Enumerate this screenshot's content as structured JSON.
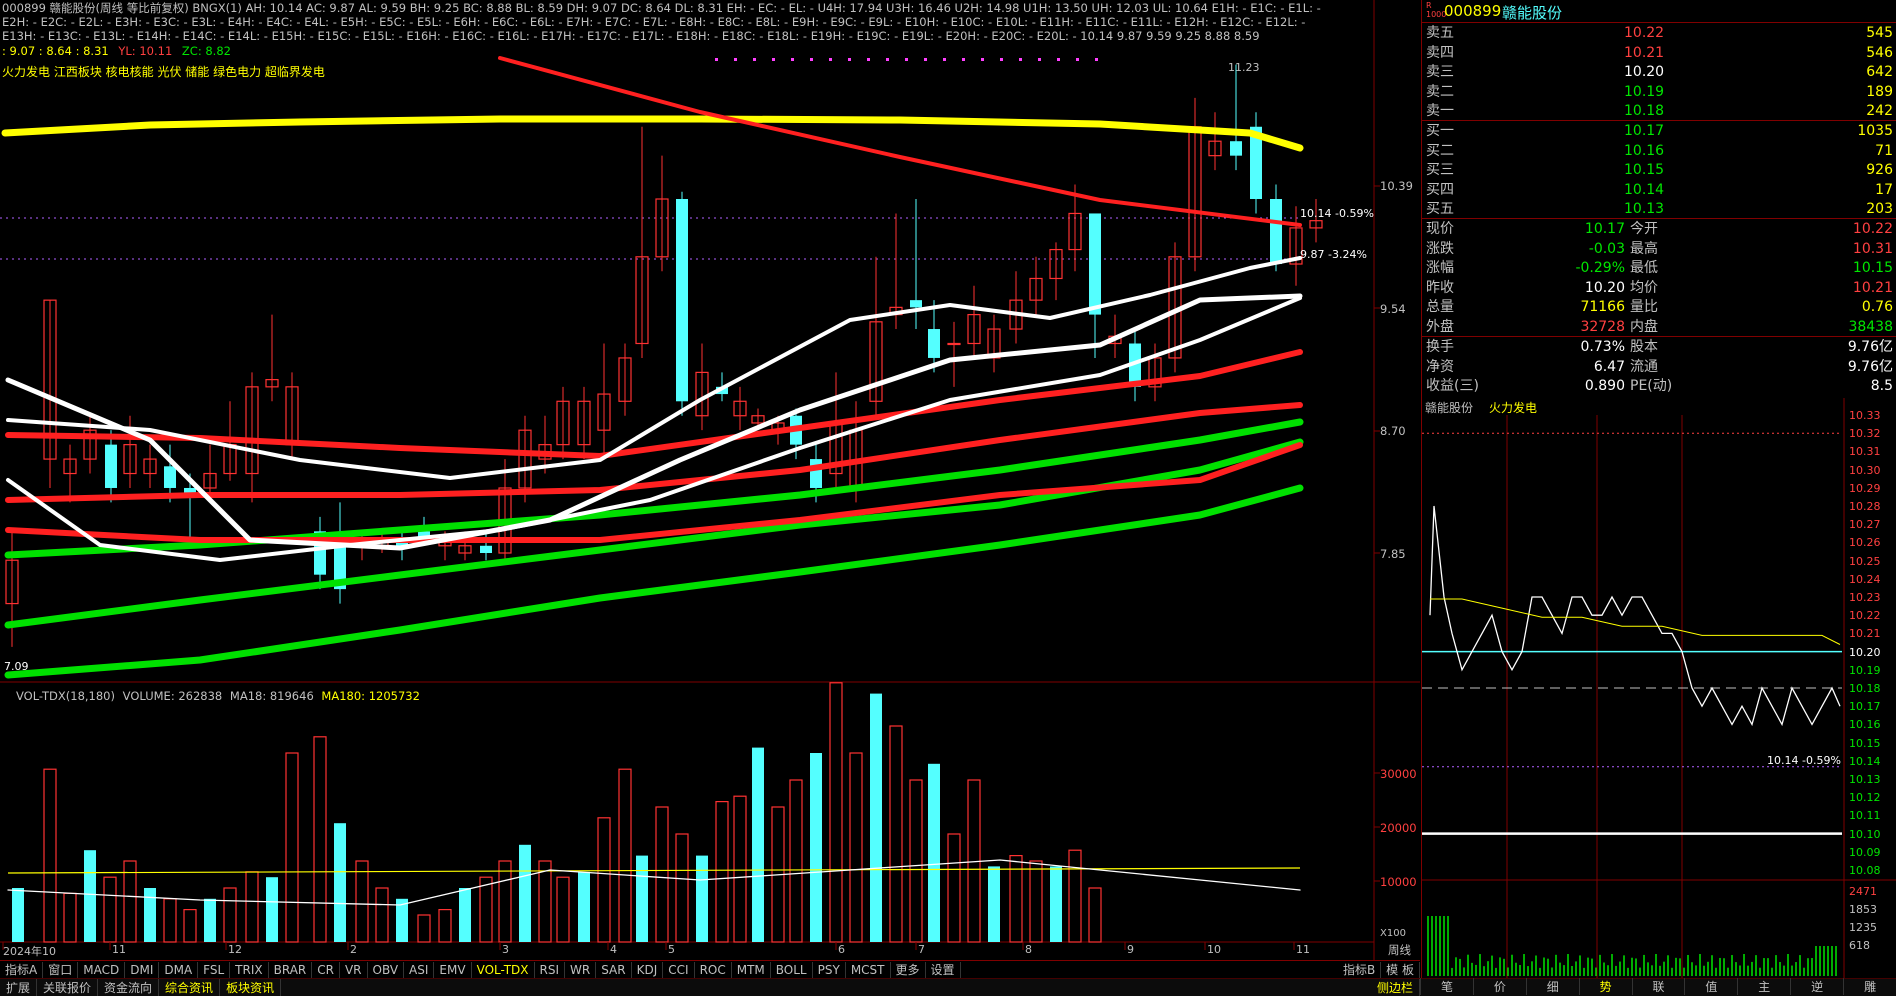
{
  "header": {
    "line1": "000899 赣能股份(周线 等比前复权)   BNGX(1) AH: 10.14  AC: 9.87  AL: 9.59  BH: 9.25  BC: 8.88  BL: 8.59  DH: 9.07  DC: 8.64  DL: 8.31  EH: -  EC: -  EL: -  U4H: 17.94  U3H: 16.46  U2H: 14.98  U1H: 13.50  UH: 12.03  UL: 10.64  E1H: -  E1C: -  E1L: -",
    "line2": "E2H: -  E2C: -  E2L: -  E3H: -  E3C: -  E3L: -  E4H: -  E4C: -  E4L: -  E5H: -  E5C: -  E5L: -  E6H: -  E6C: -  E6L: -  E7H: -  E7C: -  E7L: -  E8H: -  E8C: -  E8L: -  E9H: -  E9C: -  E9L: -  E10H: -  E10C: -  E10L: -  E11H: -  E11C: -  E11L: -  E12H: -  E12C: -  E12L: -",
    "line3": "E13H: -  E13C: -  E13L: -  E14H: -  E14C: -  E14L: -  E15H: -  E15C: -  E15L: -  E16H: -  E16C: -  E16L: -  E17H: -  E17C: -  E17L: -  E18H: -  E18C: -  E18L: -  E19H: -  E19C: -  E19L: -  E20H: -  E20C: -  E20L: -  10.14  9.87  9.59  9.25  8.88  8.59",
    "line4_a": ": 9.07 : 8.64 : 8.31",
    "line4_b": "YL: 10.11",
    "line4_c": "ZC: 8.82"
  },
  "sectors": "火力发电 江西板块 核电核能 光伏 储能 绿色电力 超临界发电",
  "price_axis": [
    "10.39",
    "9.54",
    "8.70",
    "7.85"
  ],
  "price_annotations": {
    "high": "11.23",
    "ref1": "10.14 -0.59%",
    "ref2": "9.87 -3.24%",
    "low": "7.09"
  },
  "volume": {
    "header_name": "VOL-TDX(18,180)",
    "header_volume": "VOLUME: 262838",
    "header_ma18": "MA18: 819646",
    "header_ma180": "MA180: 1205732",
    "axis": [
      "30000",
      "20000",
      "10000"
    ],
    "unit": "X100"
  },
  "time_axis": [
    "2024年10",
    "11",
    "12",
    "2",
    "3",
    "4",
    "5",
    "6",
    "7",
    "8",
    "9",
    "10",
    "11",
    "12"
  ],
  "indicator_tabs": [
    "指标A",
    "窗口",
    "MACD",
    "DMI",
    "DMA",
    "FSL",
    "TRIX",
    "BRAR",
    "CR",
    "VR",
    "OBV",
    "ASI",
    "EMV",
    "VOL-TDX",
    "RSI",
    "WR",
    "SAR",
    "KDJ",
    "CCI",
    "ROC",
    "MTM",
    "BOLL",
    "PSY",
    "MCST",
    "更多",
    "设置"
  ],
  "indicator_tab_active": "VOL-TDX",
  "indicator_tabs_right": [
    "指标B",
    "模 板"
  ],
  "period_label": "周线",
  "status_tabs": [
    "扩展",
    "关联报价",
    "资金流向",
    "综合资讯",
    "板块资讯"
  ],
  "status_right": "侧边栏",
  "quote": {
    "code": "000899",
    "name": "赣能股份",
    "asks": [
      {
        "label": "卖五",
        "price": "10.22",
        "vol": "545"
      },
      {
        "label": "卖四",
        "price": "10.21",
        "vol": "546"
      },
      {
        "label": "卖三",
        "price": "10.20",
        "vol": "642"
      },
      {
        "label": "卖二",
        "price": "10.19",
        "vol": "189"
      },
      {
        "label": "卖一",
        "price": "10.18",
        "vol": "242"
      }
    ],
    "bids": [
      {
        "label": "买一",
        "price": "10.17",
        "vol": "1035"
      },
      {
        "label": "买二",
        "price": "10.16",
        "vol": "71"
      },
      {
        "label": "买三",
        "price": "10.15",
        "vol": "926"
      },
      {
        "label": "买四",
        "price": "10.14",
        "vol": "17"
      },
      {
        "label": "买五",
        "price": "10.13",
        "vol": "203"
      }
    ],
    "stats": [
      {
        "k1": "现价",
        "v1": "10.17",
        "k2": "今开",
        "v2": "10.22"
      },
      {
        "k1": "涨跌",
        "v1": "-0.03",
        "k2": "最高",
        "v2": "10.31"
      },
      {
        "k1": "涨幅",
        "v1": "-0.29%",
        "k2": "最低",
        "v2": "10.15"
      },
      {
        "k1": "昨收",
        "v1": "10.20",
        "k2": "均价",
        "v2": "10.21"
      },
      {
        "k1": "总量",
        "v1": "71166",
        "k2": "量比",
        "v2": "0.76"
      },
      {
        "k1": "外盘",
        "v1": "32728",
        "k2": "内盘",
        "v2": "38438"
      }
    ],
    "fund": [
      {
        "k1": "换手",
        "v1": "0.73%",
        "k2": "股本",
        "v2": "9.76亿"
      },
      {
        "k1": "净资",
        "v1": "6.47",
        "k2": "流通",
        "v2": "9.76亿"
      },
      {
        "k1": "收益(三)",
        "v1": "0.890",
        "k2": "PE(动)",
        "v2": "8.5"
      }
    ]
  },
  "intraday": {
    "title": "赣能股份",
    "sector": "火力发电",
    "axis": [
      "10.33",
      "10.32",
      "10.31",
      "10.30",
      "10.29",
      "10.28",
      "10.27",
      "10.26",
      "10.25",
      "10.24",
      "10.23",
      "10.22",
      "10.21",
      "10.20",
      "10.19",
      "10.18",
      "10.17",
      "10.16",
      "10.15",
      "10.14",
      "10.13",
      "10.12",
      "10.11",
      "10.10",
      "10.09",
      "10.08"
    ],
    "annotation": "10.14 -0.59%",
    "vol_axis": [
      "2471",
      "1853",
      "1235",
      "618"
    ],
    "nav": [
      "笔",
      "价",
      "细",
      "势",
      "联",
      "值",
      "主",
      "逆",
      "雕"
    ],
    "nav_active": "势"
  },
  "colors": {
    "up": "#ff3232",
    "down": "#54ffff",
    "ma_yellow": "#ffff00",
    "ma_red": "#ff2020",
    "ma_green": "#00e000",
    "frame": "#800000"
  },
  "chart_data": [
    {
      "type": "candlestick",
      "title": "000899 赣能股份 周线",
      "ylim": [
        7.09,
        11.23
      ],
      "note": "weekly candles 2024-10 to 2025-12; moving averages yellow/white/red/green"
    },
    {
      "type": "bar",
      "title": "VOL-TDX(18,180)",
      "ylabel": "X100"
    }
  ]
}
